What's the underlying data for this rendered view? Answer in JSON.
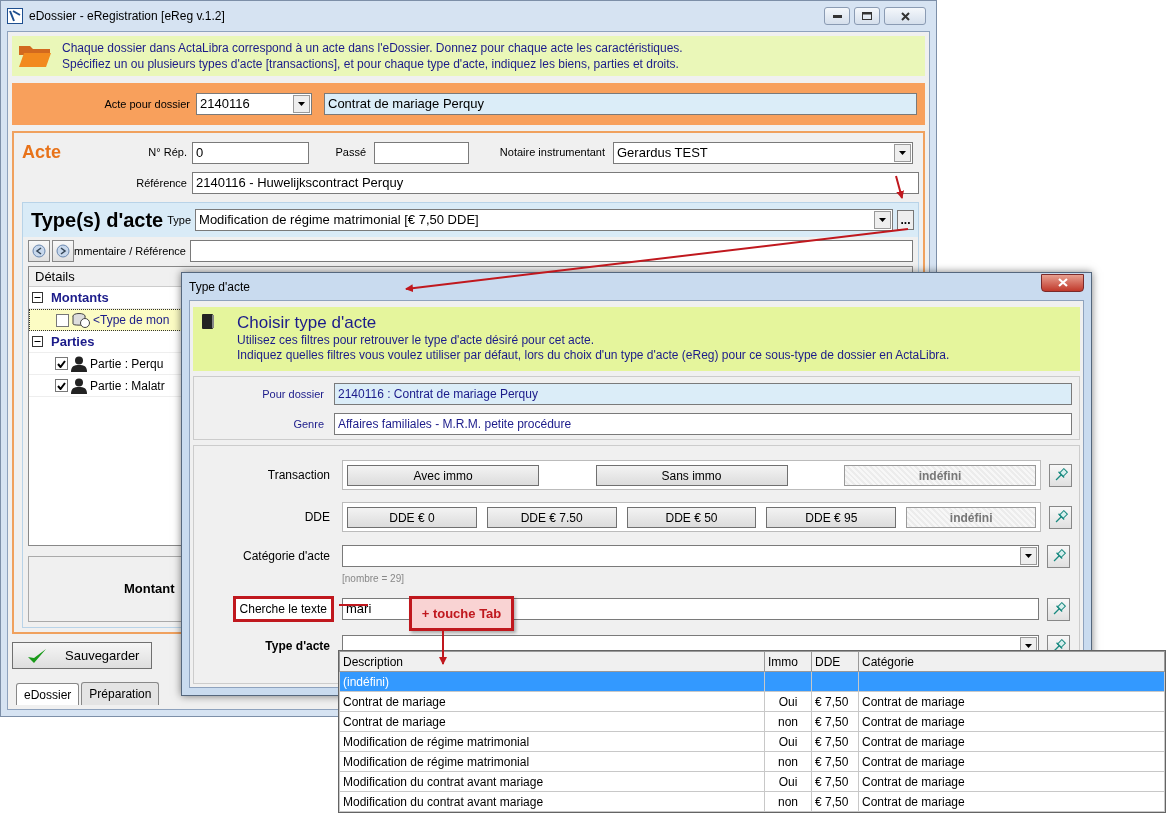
{
  "window": {
    "title": "eDossier - eRegistration [eReg v.1.2]"
  },
  "info_banner": {
    "lines": [
      "Chaque dossier dans ActaLibra correspond à un acte dans l'eDossier.  Donnez pour chaque acte les caractéristiques.",
      "Spécifiez un ou plusieurs types d'acte [transactions], et pour chaque type d'acte, indiquez les biens, parties et droits."
    ]
  },
  "dossier_bar": {
    "label": "Acte pour dossier",
    "dossier": "2140116",
    "description": "Contrat de mariage Perquy"
  },
  "acte": {
    "title": "Acte",
    "rep_label": "N° Rép.",
    "rep_value": "0",
    "passe_label": "Passé",
    "notary_label": "Notaire instrumentant",
    "notary_value": "Gerardus TEST",
    "reference_label": "Référence",
    "reference_value": "2140116 - Huwelijkscontract Perquy"
  },
  "types": {
    "title": "Type(s) d'acte",
    "type_label": "Type",
    "type_value": "Modification de régime matrimonial [€ 7,50 DDE]",
    "more_button": "...",
    "comment_label": "mmentaire / Référence"
  },
  "details": {
    "header": "Détails",
    "groups": [
      {
        "label": "Montants",
        "expanded": true,
        "children": [
          {
            "kind": "amount",
            "label": "<Type de mon",
            "checked": false,
            "selected": true
          }
        ]
      },
      {
        "label": "Parties",
        "expanded": true,
        "children": [
          {
            "kind": "party",
            "label": "Partie : Perqu",
            "checked": true,
            "selected": false
          },
          {
            "kind": "party",
            "label": "Partie : Malatr",
            "checked": true,
            "selected": false
          }
        ]
      }
    ]
  },
  "amount_panel": {
    "label": "Montant"
  },
  "save_button": "Sauvegarder",
  "bottom_tabs": [
    {
      "label": "eDossier",
      "selected": true
    },
    {
      "label": "Préparation",
      "selected": false
    }
  ],
  "dialog": {
    "title": "Type d'acte",
    "heading": "Choisir type d'acte",
    "lines": [
      "Utilisez ces filtres pour retrouver le type d'acte désiré pour cet acte.",
      "Indiquez quelles filtres vous voulez utiliser par défaut, lors du choix d'un type d'acte (eReg) pour ce sous-type de dossier en ActaLibra."
    ],
    "pour_dossier": {
      "label": "Pour dossier",
      "value": "2140116 : Contrat de mariage Perquy"
    },
    "genre": {
      "label": "Genre",
      "value": "Affaires familiales - M.R.M. petite procédure"
    },
    "filters": [
      {
        "kind": "buttons",
        "label": "Transaction",
        "options": [
          {
            "label": "Avec immo",
            "selected": false
          },
          {
            "label": "Sans immo",
            "selected": false
          },
          {
            "label": "indéfini",
            "selected": true
          }
        ]
      },
      {
        "kind": "buttons",
        "label": "DDE",
        "options": [
          {
            "label": "DDE € 0",
            "selected": false
          },
          {
            "label": "DDE € 7.50",
            "selected": false
          },
          {
            "label": "DDE € 50",
            "selected": false
          },
          {
            "label": "DDE € 95",
            "selected": false
          },
          {
            "label": "indéfini",
            "selected": true
          }
        ]
      },
      {
        "kind": "select",
        "label": "Catégorie d'acte",
        "note": "[nombre = 29]"
      },
      {
        "kind": "text",
        "label": "Cherche le texte",
        "value": "mari",
        "highlighted": true,
        "callout": "+ touche Tab"
      },
      {
        "kind": "select",
        "label": "Type d'acte",
        "emphasized": true
      }
    ]
  },
  "dropdown": {
    "columns": [
      "Description",
      "Immo",
      "DDE",
      "Catégorie"
    ],
    "rows": [
      {
        "description": "(indéfini)",
        "selected": true
      },
      {
        "description": "Contrat de mariage",
        "immo": "Oui",
        "dde": "€ 7,50",
        "category": "Contrat de mariage",
        "selected": false
      },
      {
        "description": "Contrat de mariage",
        "immo": "non",
        "dde": "€ 7,50",
        "category": "Contrat de mariage",
        "selected": false
      },
      {
        "description": "Modification de régime matrimonial",
        "immo": "Oui",
        "dde": "€ 7,50",
        "category": "Contrat de mariage",
        "selected": false
      },
      {
        "description": "Modification de régime matrimonial",
        "immo": "non",
        "dde": "€ 7,50",
        "category": "Contrat de mariage",
        "selected": false
      },
      {
        "description": "Modification du contrat avant mariage",
        "immo": "Oui",
        "dde": "€ 7,50",
        "category": "Contrat de mariage",
        "selected": false
      },
      {
        "description": "Modification du contrat avant mariage",
        "immo": "non",
        "dde": "€ 7,50",
        "category": "Contrat de mariage",
        "selected": false
      }
    ]
  }
}
